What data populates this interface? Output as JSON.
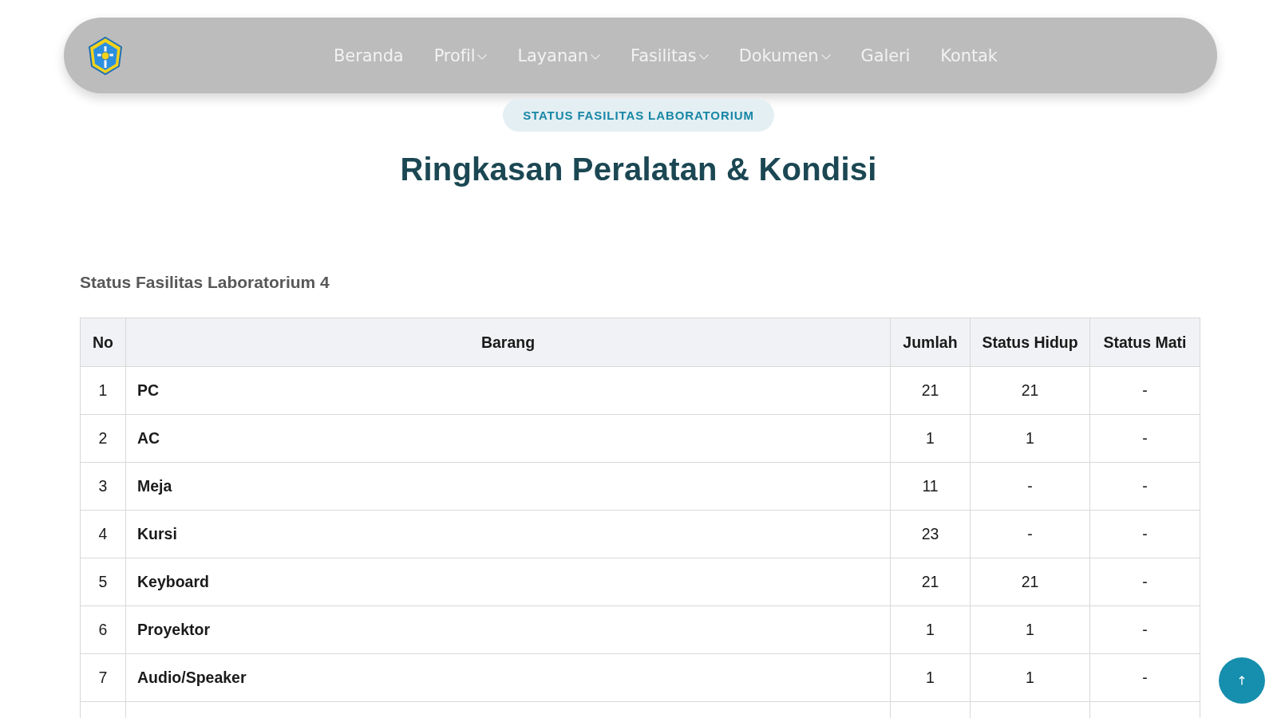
{
  "navbar": {
    "items": [
      {
        "label": "Beranda",
        "kind": "link"
      },
      {
        "label": "Profil",
        "kind": "dropdown"
      },
      {
        "label": "Layanan",
        "kind": "dropdown"
      },
      {
        "label": "Fasilitas",
        "kind": "dropdown"
      },
      {
        "label": "Dokumen",
        "kind": "dropdown"
      },
      {
        "label": "Galeri",
        "kind": "link"
      },
      {
        "label": "Kontak",
        "kind": "link"
      }
    ]
  },
  "badge": "STATUS FASILITAS LABORATORIUM",
  "title": "Ringkasan Peralatan & Kondisi",
  "section_title": "Status Fasilitas Laboratorium 4",
  "table": {
    "columns": [
      "No",
      "Barang",
      "Jumlah",
      "Status Hidup",
      "Status Mati"
    ],
    "rows": [
      [
        "1",
        "PC",
        "21",
        "21",
        "-"
      ],
      [
        "2",
        "AC",
        "1",
        "1",
        "-"
      ],
      [
        "3",
        "Meja",
        "11",
        "-",
        "-"
      ],
      [
        "4",
        "Kursi",
        "23",
        "-",
        "-"
      ],
      [
        "5",
        "Keyboard",
        "21",
        "21",
        "-"
      ],
      [
        "6",
        "Proyektor",
        "1",
        "1",
        "-"
      ],
      [
        "7",
        "Audio/Speaker",
        "1",
        "1",
        "-"
      ]
    ]
  }
}
